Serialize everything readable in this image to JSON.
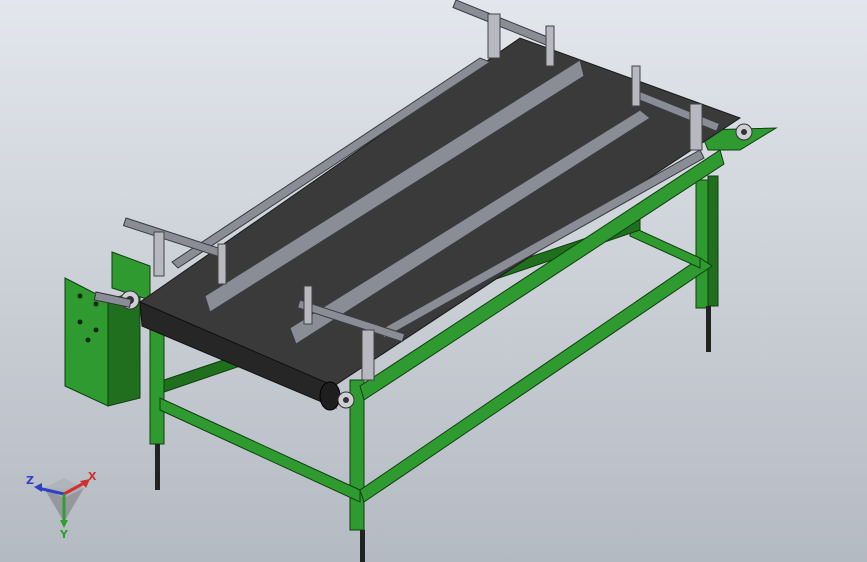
{
  "scene": {
    "background_top": "#e3e7ec",
    "background_bottom": "#b4bac2",
    "frame_color": "#2f9a2f",
    "frame_dark": "#1f6f1f",
    "belt_color": "#3a3a3a",
    "rail_color": "#8a8c96",
    "post_color": "#b8b9c0"
  },
  "triad": {
    "x_label": "X",
    "y_label": "Y",
    "z_label": "Z",
    "x_color": "#d03030",
    "y_color": "#2fa02f",
    "z_color": "#2f3fc8",
    "icon": "coordinate-triad-icon"
  }
}
